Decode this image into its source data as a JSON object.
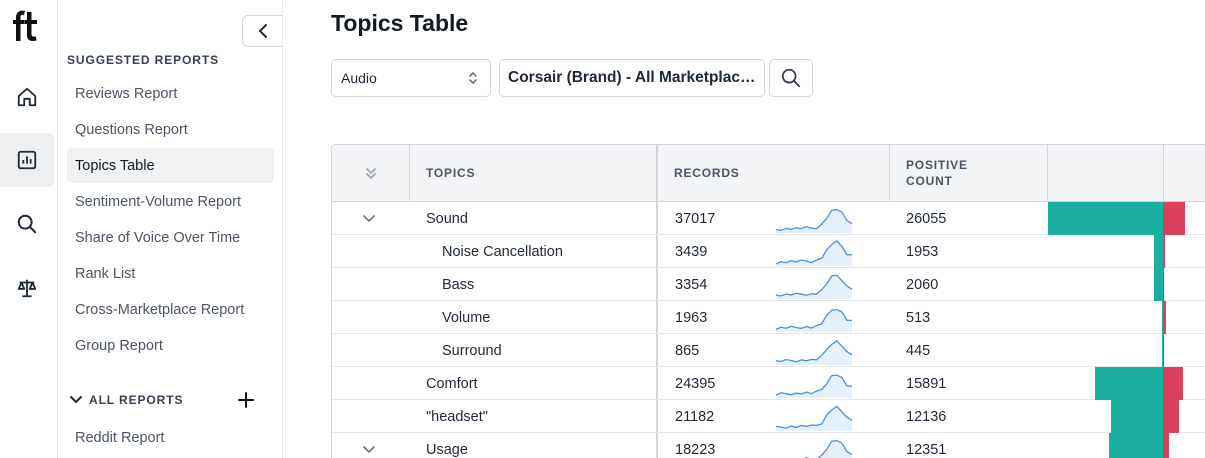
{
  "rail": {
    "logo_text": "ft",
    "items": [
      {
        "name": "home",
        "icon": "home-icon"
      },
      {
        "name": "reports",
        "icon": "bar-chart-icon",
        "active": true
      },
      {
        "name": "search",
        "icon": "search-icon"
      },
      {
        "name": "compare",
        "icon": "scale-icon"
      }
    ]
  },
  "sidebar": {
    "suggested_title": "SUGGESTED REPORTS",
    "suggested": [
      {
        "label": "Reviews Report"
      },
      {
        "label": "Questions Report"
      },
      {
        "label": "Topics Table",
        "active": true
      },
      {
        "label": "Sentiment-Volume Report"
      },
      {
        "label": "Share of Voice Over Time"
      },
      {
        "label": "Rank List"
      },
      {
        "label": "Cross-Marketplace Report"
      },
      {
        "label": "Group Report"
      }
    ],
    "all_title": "ALL REPORTS",
    "all": [
      {
        "label": "Reddit Report"
      }
    ]
  },
  "main": {
    "title": "Topics Table",
    "category_value": "Audio",
    "brand_value": "Corsair (Brand) - All Marketplaces",
    "columns": {
      "topics": "TOPICS",
      "records": "RECORDS",
      "positive_line1": "POSITIVE",
      "positive_line2": "COUNT"
    },
    "rows": [
      {
        "topic": "Sound",
        "records": "37017",
        "positive": "26055",
        "expandable": true,
        "indent": 0,
        "pos_share": 0.73,
        "neg_share": 0.14
      },
      {
        "topic": "Noise Cancellation",
        "records": "3439",
        "positive": "1953",
        "expandable": false,
        "indent": 1,
        "pos_share": 0.055,
        "neg_share": 0.012
      },
      {
        "topic": "Bass",
        "records": "3354",
        "positive": "2060",
        "expandable": false,
        "indent": 1,
        "pos_share": 0.055,
        "neg_share": 0.006
      },
      {
        "topic": "Volume",
        "records": "1963",
        "positive": "513",
        "expandable": false,
        "indent": 1,
        "pos_share": 0.006,
        "neg_share": 0.016
      },
      {
        "topic": "Surround",
        "records": "865",
        "positive": "445",
        "expandable": false,
        "indent": 1,
        "pos_share": 0.006,
        "neg_share": 0.003
      },
      {
        "topic": "Comfort",
        "records": "24395",
        "positive": "15891",
        "expandable": false,
        "indent": 0,
        "pos_share": 0.43,
        "neg_share": 0.125
      },
      {
        "topic": "\"headset\"",
        "records": "21182",
        "positive": "12136",
        "expandable": false,
        "indent": 0,
        "pos_share": 0.33,
        "neg_share": 0.1
      },
      {
        "topic": "Usage",
        "records": "18223",
        "positive": "12351",
        "expandable": true,
        "indent": 0,
        "pos_share": 0.34,
        "neg_share": 0.04
      }
    ]
  }
}
